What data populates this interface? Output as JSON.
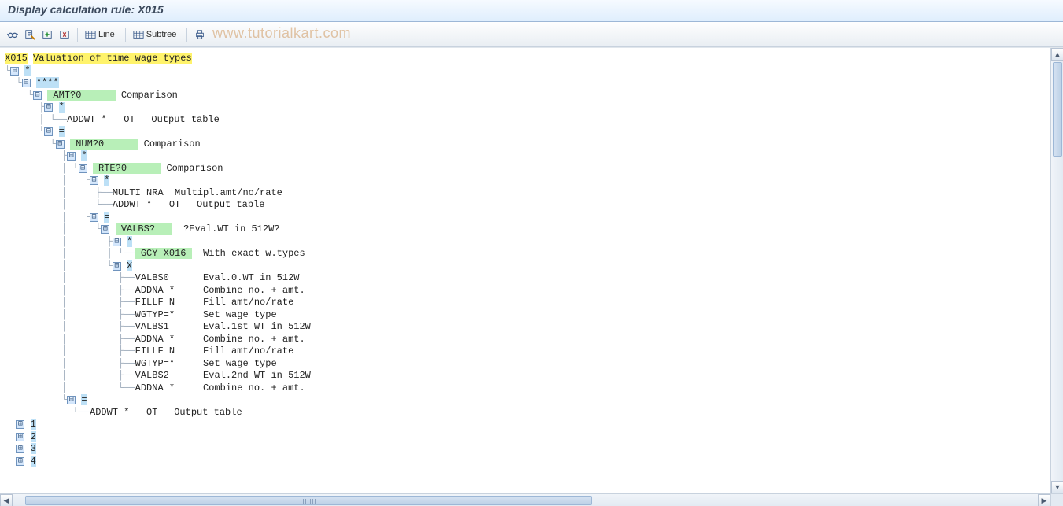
{
  "title": "Display calculation rule: X015",
  "toolbar": {
    "glasses": "Display",
    "attrib": "Attributes",
    "insert": "Insert",
    "cut": "Cut",
    "line_label": "Line",
    "subtree_label": "Subtree",
    "print": "Print"
  },
  "watermark": "www.tutorialkart.com",
  "root": {
    "code": "X015",
    "desc": "Valuation of time wage types"
  },
  "labels": {
    "star": "*",
    "fourstar": "****",
    "eq": "=",
    "x": "X",
    "one": "1",
    "two": "2",
    "three": "3",
    "four": "4"
  },
  "nodes": {
    "amt": {
      "code": "AMT?0",
      "desc": "Comparison"
    },
    "num": {
      "code": "NUM?0",
      "desc": "Comparison"
    },
    "rte": {
      "code": "RTE?0",
      "desc": "Comparison"
    },
    "valbsq": {
      "code": "VALBS?",
      "desc": "?Eval.WT in 512W?"
    },
    "gcy": {
      "code": "GCY X016",
      "desc": "With exact w.types"
    }
  },
  "ops": {
    "addwt": {
      "code": "ADDWT *",
      "col2": "OT",
      "desc": "Output table"
    },
    "multinra": {
      "code": "MULTI NRA",
      "col2": "",
      "desc": "Multipl.amt/no/rate"
    },
    "valbs0": {
      "code": "VALBS0",
      "desc": "Eval.0.WT in 512W"
    },
    "addna": {
      "code": "ADDNA *",
      "desc": "Combine no. + amt."
    },
    "fillf": {
      "code": "FILLF N",
      "desc": "Fill amt/no/rate"
    },
    "wgtyp": {
      "code": "WGTYP=*",
      "desc": "Set wage type"
    },
    "valbs1": {
      "code": "VALBS1",
      "desc": "Eval.1st WT in 512W"
    },
    "valbs2": {
      "code": "VALBS2",
      "desc": "Eval.2nd WT in 512W"
    }
  }
}
